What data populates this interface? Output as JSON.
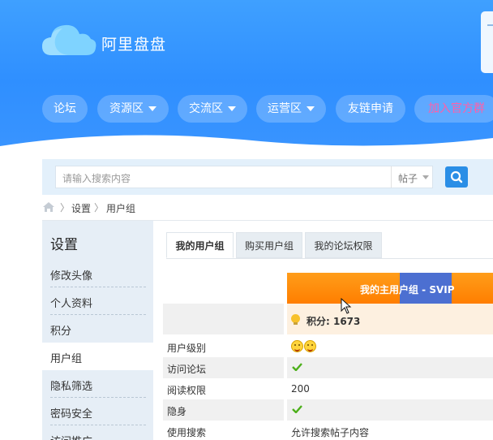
{
  "site": {
    "name": "阿里盘盘"
  },
  "nav": {
    "items": [
      {
        "label": "论坛",
        "dropdown": false
      },
      {
        "label": "资源区",
        "dropdown": true
      },
      {
        "label": "交流区",
        "dropdown": true
      },
      {
        "label": "运营区",
        "dropdown": true
      },
      {
        "label": "友链申请",
        "dropdown": false
      },
      {
        "label": "加入官方群",
        "dropdown": false
      }
    ]
  },
  "search": {
    "placeholder": "请输入搜索内容",
    "type_selected": "帖子"
  },
  "breadcrumb": {
    "items": [
      "设置",
      "用户组"
    ]
  },
  "sidebar": {
    "title": "设置",
    "items": [
      "修改头像",
      "个人资料",
      "积分",
      "用户组",
      "隐私筛选",
      "密码安全",
      "访问推广"
    ],
    "active_index": 3
  },
  "tabs": {
    "items": [
      "我的用户组",
      "购买用户组",
      "我的论坛权限"
    ],
    "active_index": 0
  },
  "usergroup": {
    "header": "我的主用户组 - SVIP",
    "points": "积分: 1673",
    "rows": [
      {
        "label": "用户级别",
        "value": ""
      },
      {
        "label": "访问论坛",
        "value": ""
      },
      {
        "label": "阅读权限",
        "value": "200"
      },
      {
        "label": "隐身",
        "value": ""
      },
      {
        "label": "使用搜索",
        "value": "允许搜索帖子内容"
      }
    ]
  },
  "colors": {
    "header_blue": "#2f8fff",
    "accent_orange": "#ff8c0a",
    "svip_blue": "#4c6fd1",
    "check_green": "#4caf1a",
    "pink_link": "#ff5fa8"
  }
}
